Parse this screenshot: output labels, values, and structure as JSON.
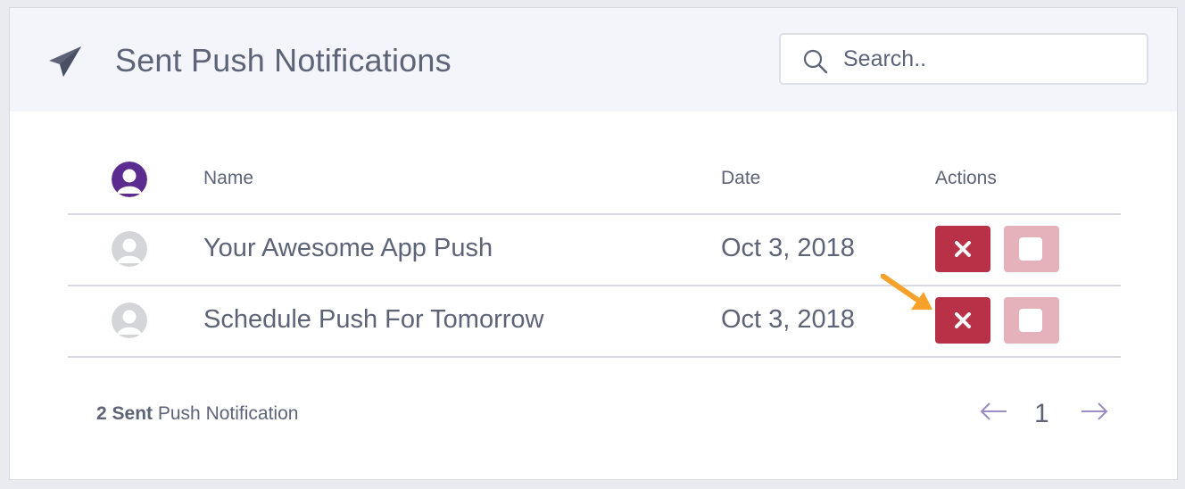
{
  "header": {
    "title": "Sent Push Notifications",
    "icon": "paper-plane-icon",
    "search_placeholder": "Search.."
  },
  "table": {
    "columns": {
      "name": "Name",
      "date": "Date",
      "actions": "Actions"
    },
    "rows": [
      {
        "name": "Your Awesome App Push",
        "date": "Oct 3, 2018"
      },
      {
        "name": "Schedule Push For Tomorrow",
        "date": "Oct 3, 2018"
      }
    ]
  },
  "footer": {
    "count_bold": "2 Sent",
    "count_rest": " Push Notification",
    "current_page": "1"
  },
  "colors": {
    "accent_purple": "#5b2b8f",
    "delete_red": "#b93147",
    "select_pink": "#e5b1bb",
    "annotation_orange": "#f5a12a"
  }
}
